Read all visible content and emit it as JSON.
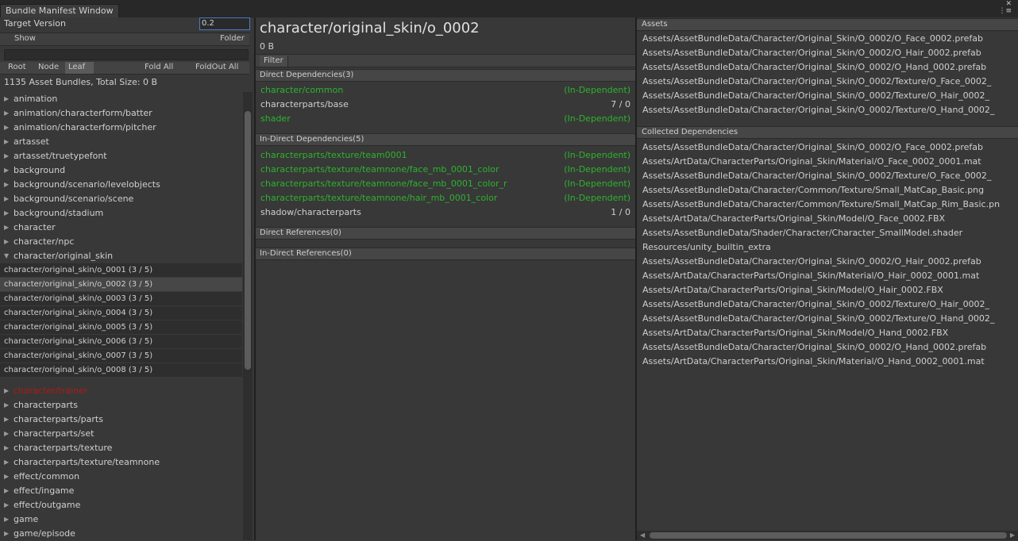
{
  "window": {
    "tab_title": "Bundle Manifest Window"
  },
  "left": {
    "target_version_label": "Target Version",
    "target_version_value": "0.2",
    "show_label": "Show",
    "folder_label": "Folder",
    "view_buttons": [
      "Root",
      "Node",
      "Leaf"
    ],
    "fold_all": "Fold All",
    "foldout_all": "FoldOut All",
    "summary": "1135 Asset Bundles, Total Size: 0 B",
    "tree_top": [
      "animation",
      "animation/characterform/batter",
      "animation/characterform/pitcher",
      "artasset",
      "artasset/truetypefont",
      "background",
      "background/scenario/levelobjects",
      "background/scenario/scene",
      "background/stadium",
      "character",
      "character/npc"
    ],
    "expanded_node": "character/original_skin",
    "leaves": [
      "character/original_skin/o_0001 (3 / 5)",
      "character/original_skin/o_0002 (3 / 5)",
      "character/original_skin/o_0003 (3 / 5)",
      "character/original_skin/o_0004 (3 / 5)",
      "character/original_skin/o_0005 (3 / 5)",
      "character/original_skin/o_0006 (3 / 5)",
      "character/original_skin/o_0007 (3 / 5)",
      "character/original_skin/o_0008 (3 / 5)"
    ],
    "red_node": "character/trainer",
    "tree_bottom": [
      "characterparts",
      "characterparts/parts",
      "characterparts/set",
      "characterparts/texture",
      "characterparts/texture/teamnone",
      "effect/common",
      "effect/ingame",
      "effect/outgame",
      "game",
      "game/episode"
    ]
  },
  "middle": {
    "title": "character/original_skin/o_0002",
    "size": "0 B",
    "filter_label": "Filter",
    "direct_deps_header": "Direct Dependencies(3)",
    "direct_deps": [
      {
        "name": "character/common",
        "value": "(In-Dependent)",
        "status": "independent"
      },
      {
        "name": "characterparts/base",
        "value": "7 / 0",
        "status": "normal"
      },
      {
        "name": "shader",
        "value": "(In-Dependent)",
        "status": "independent"
      }
    ],
    "indirect_deps_header": "In-Direct Dependencies(5)",
    "indirect_deps": [
      {
        "name": "characterparts/texture/team0001",
        "value": "(In-Dependent)",
        "status": "independent"
      },
      {
        "name": "characterparts/texture/teamnone/face_mb_0001_color",
        "value": "(In-Dependent)",
        "status": "independent"
      },
      {
        "name": "characterparts/texture/teamnone/face_mb_0001_color_r",
        "value": "(In-Dependent)",
        "status": "independent"
      },
      {
        "name": "characterparts/texture/teamnone/hair_mb_0001_color",
        "value": "(In-Dependent)",
        "status": "independent"
      },
      {
        "name": "shadow/characterparts",
        "value": "1 / 0",
        "status": "normal"
      }
    ],
    "direct_refs_header": "Direct References(0)",
    "indirect_refs_header": "In-Direct References(0)",
    "colors": {
      "independent": "#2db32d",
      "red_node": "#b21818"
    }
  },
  "right": {
    "assets_header": "Assets",
    "assets": [
      "Assets/AssetBundleData/Character/Original_Skin/O_0002/O_Face_0002.prefab",
      "Assets/AssetBundleData/Character/Original_Skin/O_0002/O_Hair_0002.prefab",
      "Assets/AssetBundleData/Character/Original_Skin/O_0002/O_Hand_0002.prefab",
      "Assets/AssetBundleData/Character/Original_Skin/O_0002/Texture/O_Face_0002_",
      "Assets/AssetBundleData/Character/Original_Skin/O_0002/Texture/O_Hair_0002_",
      "Assets/AssetBundleData/Character/Original_Skin/O_0002/Texture/O_Hand_0002_"
    ],
    "collected_header": "Collected Dependencies",
    "collected": [
      "Assets/AssetBundleData/Character/Original_Skin/O_0002/O_Face_0002.prefab",
      "Assets/ArtData/CharacterParts/Original_Skin/Material/O_Face_0002_0001.mat",
      "Assets/AssetBundleData/Character/Original_Skin/O_0002/Texture/O_Face_0002_",
      "Assets/AssetBundleData/Character/Common/Texture/Small_MatCap_Basic.png",
      "Assets/AssetBundleData/Character/Common/Texture/Small_MatCap_Rim_Basic.pn",
      "Assets/ArtData/CharacterParts/Original_Skin/Model/O_Face_0002.FBX",
      "Assets/AssetBundleData/Shader/Character/Character_SmallModel.shader",
      "Resources/unity_builtin_extra",
      "Assets/AssetBundleData/Character/Original_Skin/O_0002/O_Hair_0002.prefab",
      "Assets/ArtData/CharacterParts/Original_Skin/Material/O_Hair_0002_0001.mat",
      "Assets/ArtData/CharacterParts/Original_Skin/Model/O_Hair_0002.FBX",
      "Assets/AssetBundleData/Character/Original_Skin/O_0002/Texture/O_Hair_0002_",
      "Assets/AssetBundleData/Character/Original_Skin/O_0002/Texture/O_Hand_0002_",
      "Assets/ArtData/CharacterParts/Original_Skin/Model/O_Hand_0002.FBX",
      "Assets/AssetBundleData/Character/Original_Skin/O_0002/O_Hand_0002.prefab",
      "Assets/ArtData/CharacterParts/Original_Skin/Material/O_Hand_0002_0001.mat"
    ]
  }
}
